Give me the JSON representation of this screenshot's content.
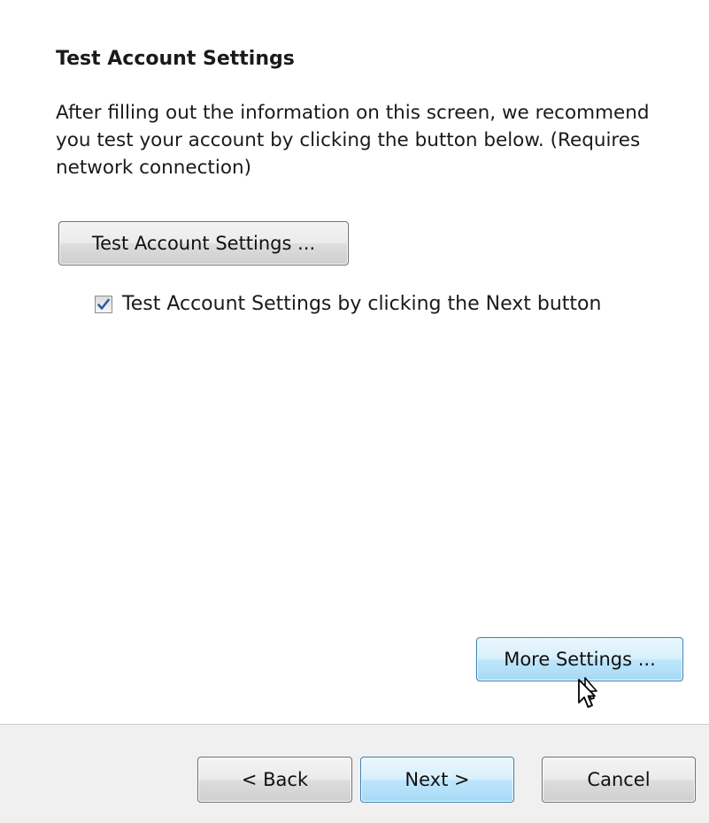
{
  "main": {
    "section_title": "Test Account Settings",
    "description": "After filling out the information on this screen, we recommend you test your account by clicking the button below. (Requires network connection)",
    "test_button_label": "Test Account Settings ...",
    "checkbox": {
      "label": "Test Account Settings by clicking the Next button",
      "checked": true
    },
    "more_settings_label": "More Settings ..."
  },
  "footer": {
    "back_label": "< Back",
    "next_label": "Next >",
    "cancel_label": "Cancel"
  },
  "icons": {
    "checkmark": "checkmark-icon",
    "cursor": "mouse-pointer-icon"
  },
  "colors": {
    "hover_border": "#3c7fb1",
    "check_color": "#3355aa",
    "footer_bg": "#f0f0f0"
  }
}
